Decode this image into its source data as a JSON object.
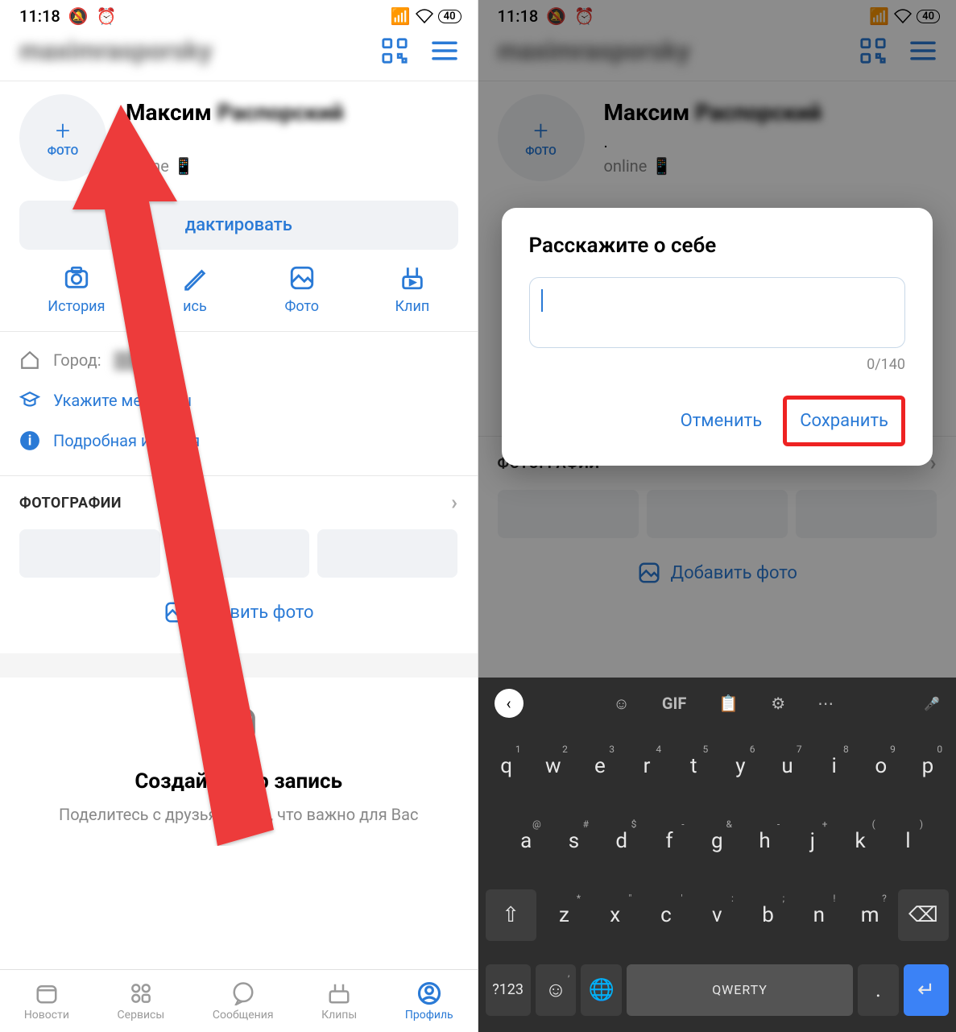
{
  "status": {
    "time": "11:18",
    "battery": "40"
  },
  "header": {
    "username_blur": "maximrasporsky"
  },
  "profile": {
    "photo_label": "ФОТО",
    "name_first": "Максим",
    "name_last_blur": "Распорский",
    "dot": ".",
    "online": "online"
  },
  "edit_label": "дактировать",
  "edit_label_full": "Редактировать",
  "quick": {
    "story": "История",
    "post": "Запись",
    "post_partial": "ись",
    "photo": "Фото",
    "clip": "Клип"
  },
  "info": {
    "city_label": "Город:",
    "education": "Укажите место учёбы",
    "education_partial": "Укажите мест      ёбы",
    "details": "Подробная информация",
    "details_partial": "Подробная ин       ация"
  },
  "photos": {
    "header": "ФОТОГРАФИИ",
    "add": "Добавить фото",
    "add_partial": "авить фото"
  },
  "create": {
    "title": "Создайте пер      запись",
    "title_full": "Создайте первую запись",
    "subtitle": "Поделитесь с друзьями тем, что важно для Вас"
  },
  "tabs": {
    "news": "Новости",
    "services": "Сервисы",
    "messages": "Сообщения",
    "clips": "Клипы",
    "profile": "Профиль"
  },
  "dialog": {
    "title": "Расскажите о себе",
    "counter": "0/140",
    "cancel": "Отменить",
    "save": "Сохранить"
  },
  "keyboard": {
    "gif": "GIF",
    "row1": [
      "q",
      "w",
      "e",
      "r",
      "t",
      "y",
      "u",
      "i",
      "o",
      "p"
    ],
    "row1_sup": [
      "1",
      "2",
      "3",
      "4",
      "5",
      "6",
      "7",
      "8",
      "9",
      "0"
    ],
    "row2": [
      "a",
      "s",
      "d",
      "f",
      "g",
      "h",
      "j",
      "k",
      "l"
    ],
    "row2_sup": [
      "@",
      "#",
      "$",
      "-",
      "&",
      "-",
      "+",
      "(",
      ")"
    ],
    "row3": [
      "z",
      "x",
      "c",
      "v",
      "b",
      "n",
      "m"
    ],
    "row3_sup": [
      "*",
      "\"",
      "'",
      ":",
      ";",
      "!",
      "?"
    ],
    "mode": "?123",
    "space": "QWERTY"
  }
}
